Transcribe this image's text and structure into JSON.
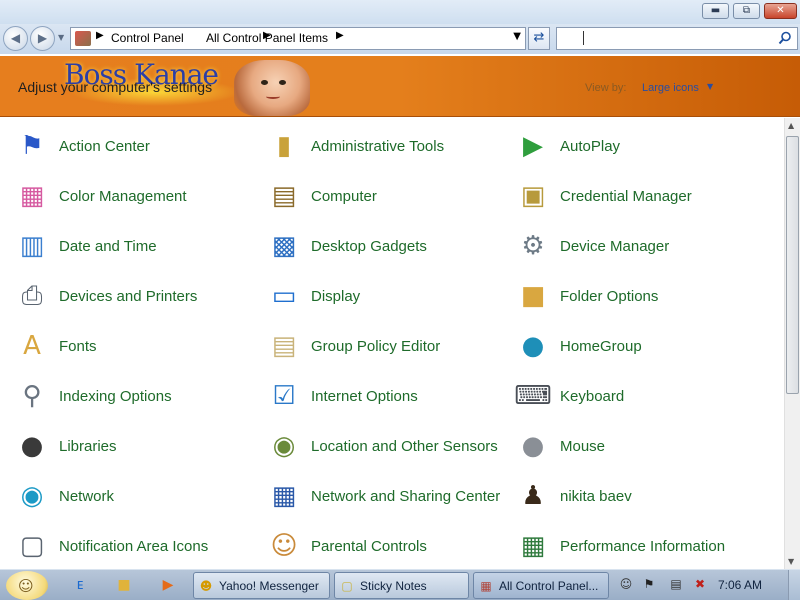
{
  "address": {
    "crumbs": [
      "Control Panel",
      "All Control Panel Items"
    ]
  },
  "header": {
    "title": "Adjust your computer's settings",
    "brand": "Boss Kanae",
    "view_by_label": "View by:",
    "view_by_value": "Large icons"
  },
  "items": [
    {
      "label": "Action Center",
      "icon": "action-center-flag-icon"
    },
    {
      "label": "Administrative Tools",
      "icon": "administrative-tools-icon"
    },
    {
      "label": "AutoPlay",
      "icon": "autoplay-icon"
    },
    {
      "label": "Color Management",
      "icon": "color-management-icon"
    },
    {
      "label": "Computer",
      "icon": "computer-icon"
    },
    {
      "label": "Credential Manager",
      "icon": "credential-manager-vault-icon"
    },
    {
      "label": "Date and Time",
      "icon": "date-and-time-calendar-icon"
    },
    {
      "label": "Desktop Gadgets",
      "icon": "desktop-gadgets-icon"
    },
    {
      "label": "Device Manager",
      "icon": "device-manager-icon"
    },
    {
      "label": "Devices and Printers",
      "icon": "devices-and-printers-icon"
    },
    {
      "label": "Display",
      "icon": "display-monitor-icon"
    },
    {
      "label": "Folder Options",
      "icon": "folder-options-icon"
    },
    {
      "label": "Fonts",
      "icon": "fonts-folder-icon"
    },
    {
      "label": "Group Policy Editor",
      "icon": "group-policy-editor-icon"
    },
    {
      "label": "HomeGroup",
      "icon": "homegroup-globe-icon"
    },
    {
      "label": "Indexing Options",
      "icon": "indexing-options-icon"
    },
    {
      "label": "Internet Options",
      "icon": "internet-options-icon"
    },
    {
      "label": "Keyboard",
      "icon": "keyboard-icon"
    },
    {
      "label": "Libraries",
      "icon": "libraries-icon"
    },
    {
      "label": "Location and Other Sensors",
      "icon": "location-sensors-icon"
    },
    {
      "label": "Mouse",
      "icon": "mouse-icon"
    },
    {
      "label": "Network",
      "icon": "network-globe-icon"
    },
    {
      "label": "Network and Sharing Center",
      "icon": "network-sharing-center-icon"
    },
    {
      "label": "nikita baev",
      "icon": "user-account-icon"
    },
    {
      "label": "Notification Area Icons",
      "icon": "notification-area-icons-icon"
    },
    {
      "label": "Parental Controls",
      "icon": "parental-controls-icon"
    },
    {
      "label": "Performance Information",
      "icon": "performance-information-icon"
    }
  ],
  "taskbar": {
    "tasks": [
      {
        "label": "Yahoo! Messenger",
        "icon": "yahoo-messenger-icon"
      },
      {
        "label": "Sticky Notes",
        "icon": "sticky-notes-icon"
      },
      {
        "label": "All Control Panel...",
        "icon": "control-panel-icon"
      }
    ],
    "clock": "7:06 AM"
  },
  "colors": {
    "link_green": "#1e6b2a",
    "header_orange": "#e67e1e",
    "view_by_blue": "#2a4da0"
  }
}
